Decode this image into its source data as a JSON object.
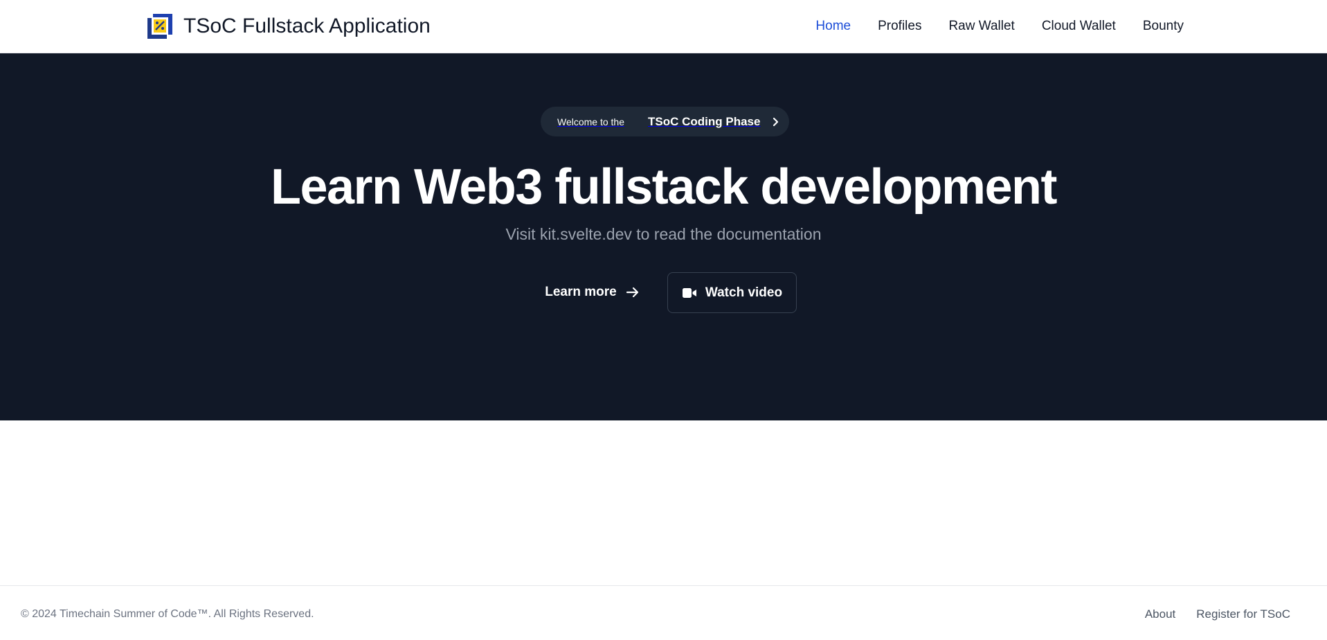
{
  "colors": {
    "nav_active": "#1d4ed8",
    "hero_background": "#111827",
    "pill_background": "#1f2937",
    "logo_blue": "#1e3a8a",
    "logo_yellow": "#facc15"
  },
  "navbar": {
    "brand_title": "TSoC Fullstack Application",
    "logo_icon": "tsoc-logo-icon",
    "links": [
      {
        "label": "Home",
        "active": true
      },
      {
        "label": "Profiles",
        "active": false
      },
      {
        "label": "Raw Wallet",
        "active": false
      },
      {
        "label": "Cloud Wallet",
        "active": false
      },
      {
        "label": "Bounty",
        "active": false
      }
    ]
  },
  "hero": {
    "pill": {
      "prefix": "Welcome to the",
      "strong": "TSoC Coding Phase",
      "icon": "chevron-right-icon"
    },
    "title": "Learn Web3 fullstack development",
    "subtitle": "Visit kit.svelte.dev to read the documentation",
    "learn_more": {
      "label": "Learn more",
      "icon": "arrow-right-icon"
    },
    "watch_video": {
      "label": "Watch video",
      "icon": "video-camera-icon"
    }
  },
  "footer": {
    "copyright": "© 2024 Timechain Summer of Code™. All Rights Reserved.",
    "links": [
      "About",
      "Register for TSoC"
    ]
  }
}
